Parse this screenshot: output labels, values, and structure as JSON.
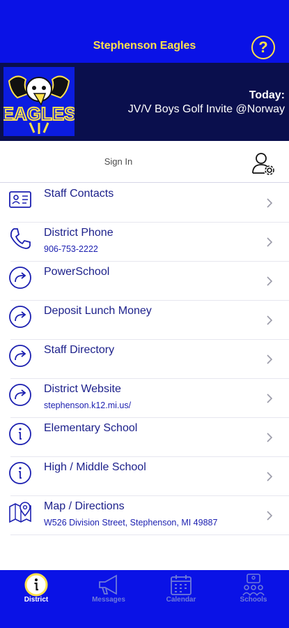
{
  "header": {
    "title": "Stephenson Eagles",
    "help_label": "?",
    "colors": {
      "primary": "#0a12e6",
      "accent": "#ffe14a"
    }
  },
  "banner": {
    "logo_text": "EAGLES",
    "today_label": "Today:",
    "today_event": "JV/V Boys Golf Invite @Norway"
  },
  "signin": {
    "label": "Sign In"
  },
  "menu": {
    "items": [
      {
        "label": "Staff Contacts",
        "sub": "",
        "icon": "contact-card-icon"
      },
      {
        "label": "District Phone",
        "sub": "906-753-2222",
        "icon": "phone-icon"
      },
      {
        "label": "PowerSchool",
        "sub": "",
        "icon": "link-arrow-icon"
      },
      {
        "label": "Deposit Lunch Money",
        "sub": "",
        "icon": "link-arrow-icon"
      },
      {
        "label": "Staff Directory",
        "sub": "",
        "icon": "link-arrow-icon"
      },
      {
        "label": "District Website",
        "sub": "stephenson.k12.mi.us/",
        "icon": "link-arrow-icon"
      },
      {
        "label": "Elementary School",
        "sub": "",
        "icon": "info-icon"
      },
      {
        "label": "High / Middle School",
        "sub": "",
        "icon": "info-icon"
      },
      {
        "label": "Map / Directions",
        "sub": "W526 Division Street, Stephenson, MI 49887",
        "icon": "map-pin-icon"
      }
    ]
  },
  "tabs": [
    {
      "label": "District",
      "icon": "info-icon",
      "active": true
    },
    {
      "label": "Messages",
      "icon": "megaphone-icon",
      "active": false
    },
    {
      "label": "Calendar",
      "icon": "calendar-icon",
      "active": false
    },
    {
      "label": "Schools",
      "icon": "schools-icon",
      "active": false
    }
  ]
}
